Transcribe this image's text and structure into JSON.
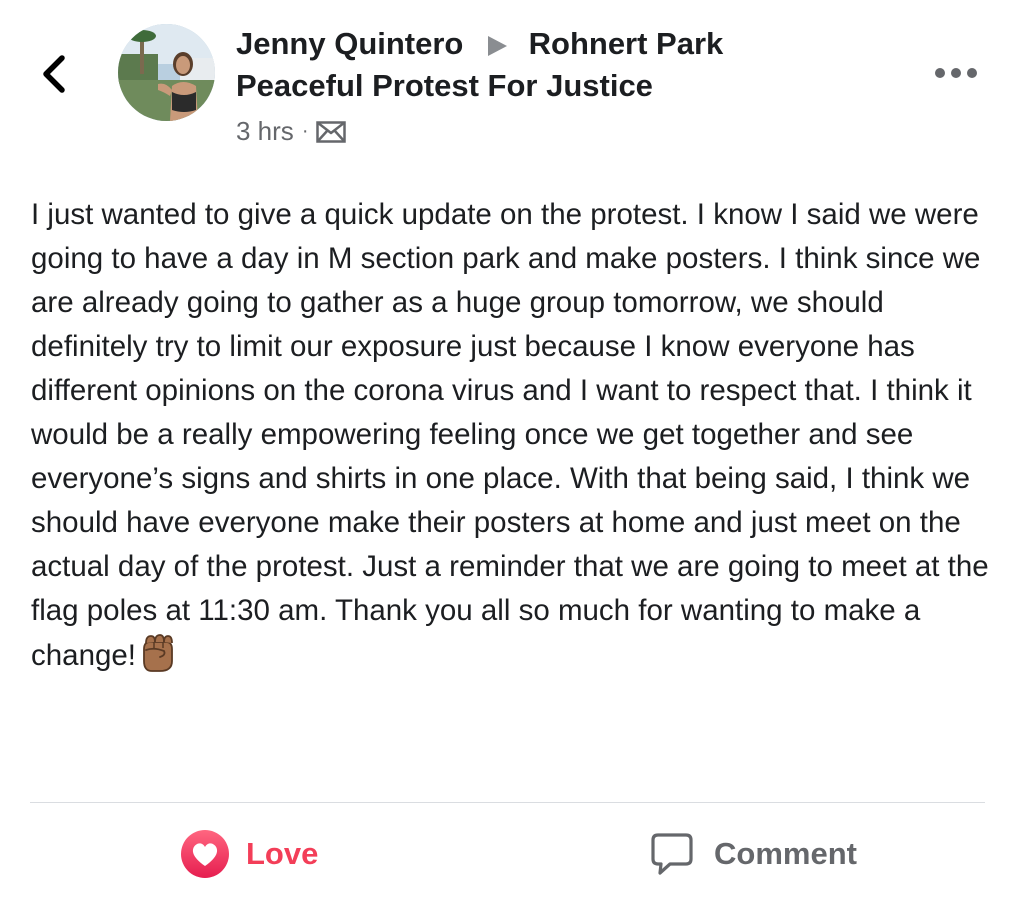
{
  "header": {
    "back_icon": "chevron-left-icon",
    "author": "Jenny Quintero",
    "arrow_icon": "triangle-right-icon",
    "group_line1": "Rohnert Park",
    "group_line2": "Peaceful Protest For Justice",
    "time": "3 hrs",
    "separator": "·",
    "privacy_icon": "envelope-icon",
    "more_icon": "more-horizontal-icon"
  },
  "post": {
    "text": "I just wanted to give a quick update on the protest. I know I said we were going to have a day in M section park and make posters. I think since we are already going to gather as a huge group tomorrow, we should definitely try to limit our exposure just because I know everyone has different opinions on the corona virus and I want to respect that. I think it would be a really empowering feeling once we get together and see everyone’s signs and shirts in one place. With that being said, I think we should have everyone make their posters at home and just meet on the actual day of the protest. Just a reminder that we are going to meet at the flag poles at 11:30 am. Thank you all so much for wanting to make a change!",
    "emoji": "raised-fist-emoji"
  },
  "actions": {
    "love_label": "Love",
    "love_icon": "heart-icon",
    "comment_label": "Comment",
    "comment_icon": "comment-bubble-icon"
  },
  "colors": {
    "love": "#f33e58",
    "secondary_text": "#65676b",
    "primary_text": "#1c1e21"
  }
}
